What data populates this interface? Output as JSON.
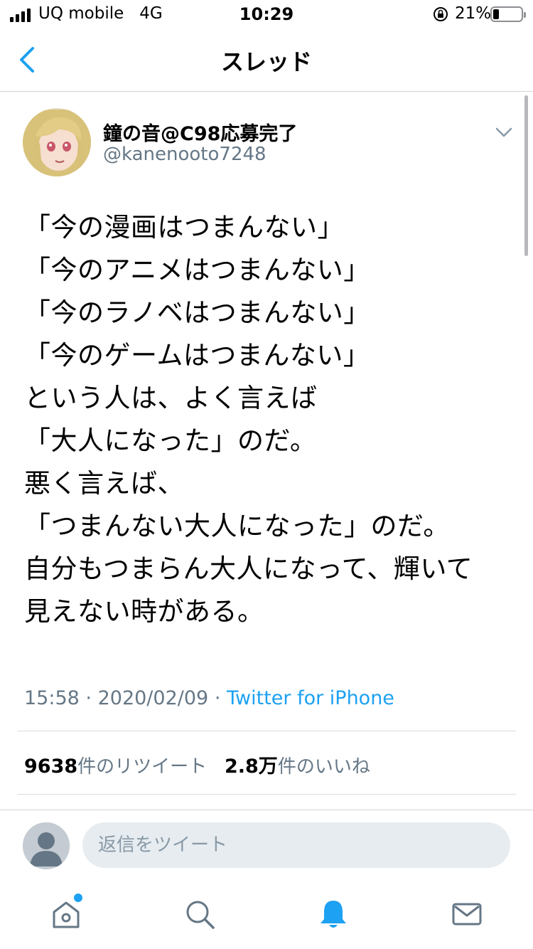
{
  "status_bar": {
    "carrier": "UQ mobile   4G",
    "time": "10:29",
    "battery": "21%",
    "battery_level": 0.21
  },
  "header": {
    "title": "スレッド",
    "back_icon": "chevron-left-icon"
  },
  "tweet": {
    "author_name": "鐘の音@C98応募完了",
    "handle": "@kanenooto7248",
    "lines": [
      "「今の漫画はつまんない」",
      "「今のアニメはつまんない」",
      "「今のラノベはつまんない」",
      "「今のゲームはつまんない」",
      "という人は、よく言えば",
      "「大人になった」のだ。",
      "悪く言えば、",
      "「つまんない大人になった」のだ。",
      "自分もつまらん大人になって、輝いて",
      "見えない時がある。"
    ],
    "time": "15:58",
    "date": "2020/02/09",
    "separator": "·",
    "source": "Twitter for iPhone",
    "retweet_count": "9638",
    "retweet_label": "件のリツイート",
    "like_count": "2.8万",
    "like_label": "件のいいね"
  },
  "reply": {
    "placeholder": "返信をツイート"
  },
  "tabbar": {
    "items": [
      "home-icon",
      "search-icon",
      "notifications-icon",
      "messages-icon"
    ],
    "active": "notifications-icon"
  },
  "colors": {
    "accent": "#1da1f2",
    "secondary_text": "#657786"
  }
}
